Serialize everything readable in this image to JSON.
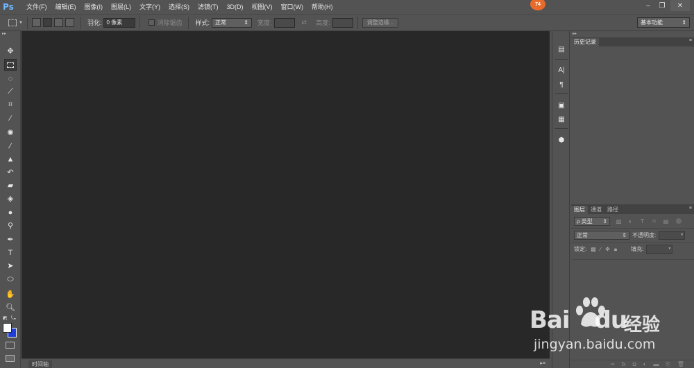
{
  "app": {
    "logo": "Ps",
    "notification_count": "74"
  },
  "menu": [
    "文件(F)",
    "编辑(E)",
    "图像(I)",
    "图层(L)",
    "文字(Y)",
    "选择(S)",
    "滤镜(T)",
    "3D(D)",
    "视图(V)",
    "窗口(W)",
    "帮助(H)"
  ],
  "window_controls": {
    "minimize": "–",
    "restore": "❐",
    "close": "✕"
  },
  "options": {
    "feather_label": "羽化:",
    "feather_value": "0 像素",
    "antialias_label": "消除锯齿",
    "style_label": "样式:",
    "style_value": "正常",
    "width_label": "宽度:",
    "height_label": "高度:",
    "refine_edge": "调整边缘...",
    "workspace": "基本功能"
  },
  "timeline": {
    "tab": "时间轴"
  },
  "history_panel": {
    "tab": "历史记录"
  },
  "layers_panel": {
    "tabs": [
      "图层",
      "通道",
      "路径"
    ],
    "filter_type": "ρ 类型",
    "blend_mode": "正常",
    "opacity_label": "不透明度:",
    "lock_label": "锁定:",
    "fill_label": "填充:"
  },
  "watermark": {
    "brand_latin": "Bai",
    "brand_du": "du",
    "brand_cn": "经验",
    "url": "jingyan.baidu.com"
  },
  "colors": {
    "ui_bg": "#535353",
    "canvas_bg": "#282828",
    "accent_badge": "#e96b2b",
    "foreground_swatch": "#ffffff",
    "background_swatch": "#1f3fd8"
  }
}
